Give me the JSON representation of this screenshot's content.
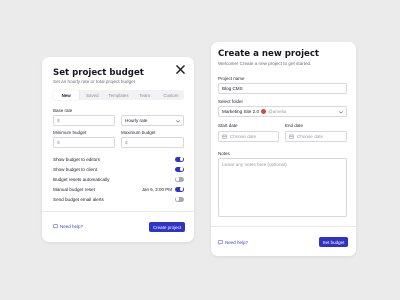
{
  "budget": {
    "title": "Set project budget",
    "subtitle": "Set an hourly rate or total project budget",
    "tabs": [
      {
        "label": "New"
      },
      {
        "label": "Saved"
      },
      {
        "label": "Templates"
      },
      {
        "label": "Team"
      },
      {
        "label": "Custom"
      }
    ],
    "base_rate_label": "Base rate",
    "currency_symbol": "$",
    "base_rate_value": "",
    "rate_type": "Hourly rate",
    "min_budget_label": "Minimum budget",
    "max_budget_label": "Maximum budget",
    "toggles": [
      {
        "label": "Show budget to editors",
        "on": true
      },
      {
        "label": "Show budget to client",
        "on": true
      },
      {
        "label": "Budget resets automatically",
        "on": false
      },
      {
        "label": "Manual budget reset",
        "date": "Jan 6, 2:00 PM",
        "on": true
      },
      {
        "label": "Send budget email alerts",
        "on": false
      }
    ],
    "help_label": "Need help?",
    "submit_label": "Create project"
  },
  "project": {
    "title": "Create a new project",
    "subtitle": "Welcome! Create a new project to get started.",
    "name_label": "Project name",
    "name_value": "Blog CMS",
    "folder_label": "Select folder",
    "folder_value": "Marketing Site 2.0",
    "folder_owner": "@amelia",
    "start_label": "Start date",
    "end_label": "End date",
    "date_placeholder": "Choose date",
    "notes_label": "Notes",
    "notes_placeholder": "Leave any notes here (optional)",
    "help_label": "Need help?",
    "submit_label": "Set budget"
  },
  "colors": {
    "accent": "#2f34c9",
    "background": "#ebebeb",
    "card": "#ffffff"
  },
  "icons": {
    "close": "close-icon",
    "help": "chat-bubble-icon",
    "calendar": "calendar-icon",
    "chevron": "chevron-down-icon"
  }
}
